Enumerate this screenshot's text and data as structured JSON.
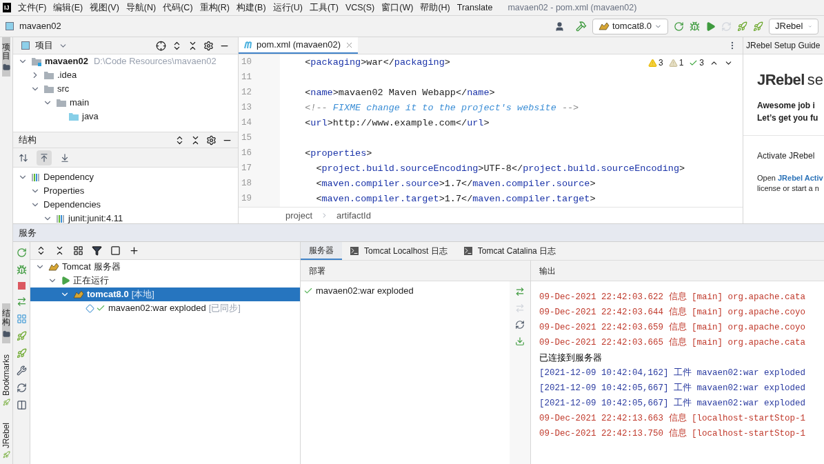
{
  "menu_bar": {
    "app_logo": "IJ",
    "items": [
      "文件(F)",
      "编辑(E)",
      "视图(V)",
      "导航(N)",
      "代码(C)",
      "重构(R)",
      "构建(B)",
      "运行(U)",
      "工具(T)",
      "VCS(S)",
      "窗口(W)",
      "帮助(H)",
      "Translate"
    ],
    "window_title": "mavaen02 - pom.xml (mavaen02)"
  },
  "nav_bar": {
    "project": "mavaen02",
    "run_config": "tomcat8.0",
    "jrebel_config": "JRebel"
  },
  "side_tabs": [
    {
      "label": "项目",
      "kind": "cjk",
      "selected": true
    },
    {
      "label": "结构",
      "kind": "cjk",
      "selected": true
    },
    {
      "label": "Bookmarks",
      "kind": "latin",
      "selected": false
    },
    {
      "label": "JRebel",
      "kind": "latin",
      "selected": false
    }
  ],
  "project_panel": {
    "title": "项目",
    "tree": [
      {
        "label": "mavaen02",
        "hint": "D:\\Code Resources\\mavaen02",
        "kind": "module",
        "expanded": true,
        "children": [
          {
            "label": ".idea",
            "kind": "folder",
            "expanded": false
          },
          {
            "label": "src",
            "kind": "folder",
            "expanded": true,
            "children": [
              {
                "label": "main",
                "kind": "folder",
                "expanded": true,
                "children": [
                  {
                    "label": "java",
                    "kind": "source"
                  }
                ]
              }
            ]
          }
        ]
      }
    ]
  },
  "structure_panel": {
    "title": "结构",
    "toggles": [
      {
        "kind": "sort",
        "selected": false
      },
      {
        "kind": "up",
        "selected": true
      },
      {
        "kind": "down",
        "selected": false
      }
    ],
    "tree": [
      {
        "label": "Dependency",
        "kind": "maven",
        "expanded": true,
        "children": [
          {
            "label": "Properties",
            "expanded": true
          },
          {
            "label": "Dependencies",
            "expanded": true,
            "children": [
              {
                "label": "junit:junit:4.11",
                "kind": "maven",
                "expanded": true
              }
            ]
          }
        ]
      }
    ]
  },
  "editor": {
    "tab": "pom.xml (mavaen02)",
    "inspections": {
      "warnings": "3",
      "weak_warnings": "1",
      "typos": "3"
    },
    "lines": [
      {
        "number": "10",
        "segments": [
          {
            "kind": "punct",
            "text": "  <"
          },
          {
            "kind": "tag",
            "text": "packaging"
          },
          {
            "kind": "punct",
            "text": ">war</"
          },
          {
            "kind": "tag",
            "text": "packaging"
          },
          {
            "kind": "punct",
            "text": ">"
          }
        ]
      },
      {
        "number": "11"
      },
      {
        "number": "12",
        "segments": [
          {
            "kind": "punct",
            "text": "  <"
          },
          {
            "kind": "tag",
            "text": "name"
          },
          {
            "kind": "punct",
            "text": ">mavaen02 Maven Webapp</"
          },
          {
            "kind": "tag",
            "text": "name"
          },
          {
            "kind": "punct",
            "text": ">"
          }
        ]
      },
      {
        "number": "13",
        "segments": [
          {
            "kind": "comment-mark",
            "text": "  <!--"
          },
          {
            "kind": "comment",
            "text": " FIXME change it to the project's website "
          },
          {
            "kind": "comment-mark",
            "text": "-->"
          }
        ]
      },
      {
        "number": "14",
        "segments": [
          {
            "kind": "punct",
            "text": "  <"
          },
          {
            "kind": "tag",
            "text": "url"
          },
          {
            "kind": "punct",
            "text": ">http://www.example.com</"
          },
          {
            "kind": "tag",
            "text": "url"
          },
          {
            "kind": "punct",
            "text": ">"
          }
        ]
      },
      {
        "number": "15"
      },
      {
        "number": "16",
        "segments": [
          {
            "kind": "punct",
            "text": "  <"
          },
          {
            "kind": "tag",
            "text": "properties"
          },
          {
            "kind": "punct",
            "text": ">"
          }
        ]
      },
      {
        "number": "17",
        "segments": [
          {
            "kind": "punct",
            "text": "    <"
          },
          {
            "kind": "tag",
            "text": "project.build.sourceEncoding"
          },
          {
            "kind": "punct",
            "text": ">UTF-8</"
          },
          {
            "kind": "tag",
            "text": "project.build.sourceEncoding"
          },
          {
            "kind": "punct",
            "text": ">"
          }
        ]
      },
      {
        "number": "18",
        "segments": [
          {
            "kind": "punct",
            "text": "    <"
          },
          {
            "kind": "tag",
            "text": "maven.compiler.source"
          },
          {
            "kind": "punct",
            "text": ">1.7</"
          },
          {
            "kind": "tag",
            "text": "maven.compiler.source"
          },
          {
            "kind": "punct",
            "text": ">"
          }
        ]
      },
      {
        "number": "19",
        "segments": [
          {
            "kind": "punct",
            "text": "    <"
          },
          {
            "kind": "tag",
            "text": "maven.compiler.target"
          },
          {
            "kind": "punct",
            "text": ">1.7</"
          },
          {
            "kind": "tag",
            "text": "maven.compiler.target"
          },
          {
            "kind": "punct",
            "text": ">"
          }
        ]
      }
    ],
    "breadcrumbs": [
      "project",
      "artifactId"
    ]
  },
  "jrebel_panel": {
    "title": "JRebel Setup Guide",
    "logo": "JRebel",
    "logo_tail": "se",
    "headline": [
      "Awesome job i",
      "Let’s get you fu"
    ],
    "activate_title": "Activate JRebel",
    "activate_text": "Open ",
    "activate_link": "JRebel Activ",
    "activate_text_end": "license or start a n"
  },
  "services": {
    "title": "服务",
    "tree": [
      {
        "label": "Tomcat 服务器",
        "kind": "tomcat",
        "expanded": true,
        "selected": false,
        "children": [
          {
            "label": "正在运行",
            "kind": "running",
            "expanded": true,
            "selected": false,
            "children": [
              {
                "label": "tomcat8.0",
                "tag": "[本地]",
                "kind": "server",
                "expanded": true,
                "selected": true,
                "children": [
                  {
                    "label": "mavaen02:war exploded",
                    "tag": "[已同步]",
                    "kind": "artifact",
                    "selected": false
                  }
                ]
              }
            ]
          }
        ]
      }
    ],
    "tabs": [
      {
        "label": "服务器",
        "kind": "plain",
        "selected": true
      },
      {
        "label": "Tomcat Localhost 日志",
        "kind": "log",
        "selected": false
      },
      {
        "label": "Tomcat Catalina 日志",
        "kind": "log",
        "selected": false
      }
    ],
    "deployment": {
      "header": "部署",
      "items": [
        "mavaen02:war exploded"
      ]
    },
    "output": {
      "header": "输出",
      "lines": [
        {
          "kind": "info",
          "text": "09-Dec-2021 22:42:03.622 信息 [main] org.apache.cata"
        },
        {
          "kind": "info",
          "text": "09-Dec-2021 22:42:03.644 信息 [main] org.apache.coyo"
        },
        {
          "kind": "info",
          "text": "09-Dec-2021 22:42:03.659 信息 [main] org.apache.coyo"
        },
        {
          "kind": "info",
          "text": "09-Dec-2021 22:42:03.665 信息 [main] org.apache.cata"
        },
        {
          "kind": "plain",
          "text": "已连接到服务器"
        },
        {
          "kind": "artifact",
          "text": "[2021-12-09 10:42:04,162] 工件 mavaen02:war exploded"
        },
        {
          "kind": "artifact",
          "text": "[2021-12-09 10:42:05,667] 工件 mavaen02:war exploded"
        },
        {
          "kind": "artifact",
          "text": "[2021-12-09 10:42:05,667] 工件 mavaen02:war exploded"
        },
        {
          "kind": "info",
          "text": "09-Dec-2021 22:42:13.663 信息 [localhost-startStop-1"
        },
        {
          "kind": "info",
          "text": "09-Dec-2021 22:42:13.750 信息 [localhost-startStop-1"
        }
      ]
    }
  }
}
